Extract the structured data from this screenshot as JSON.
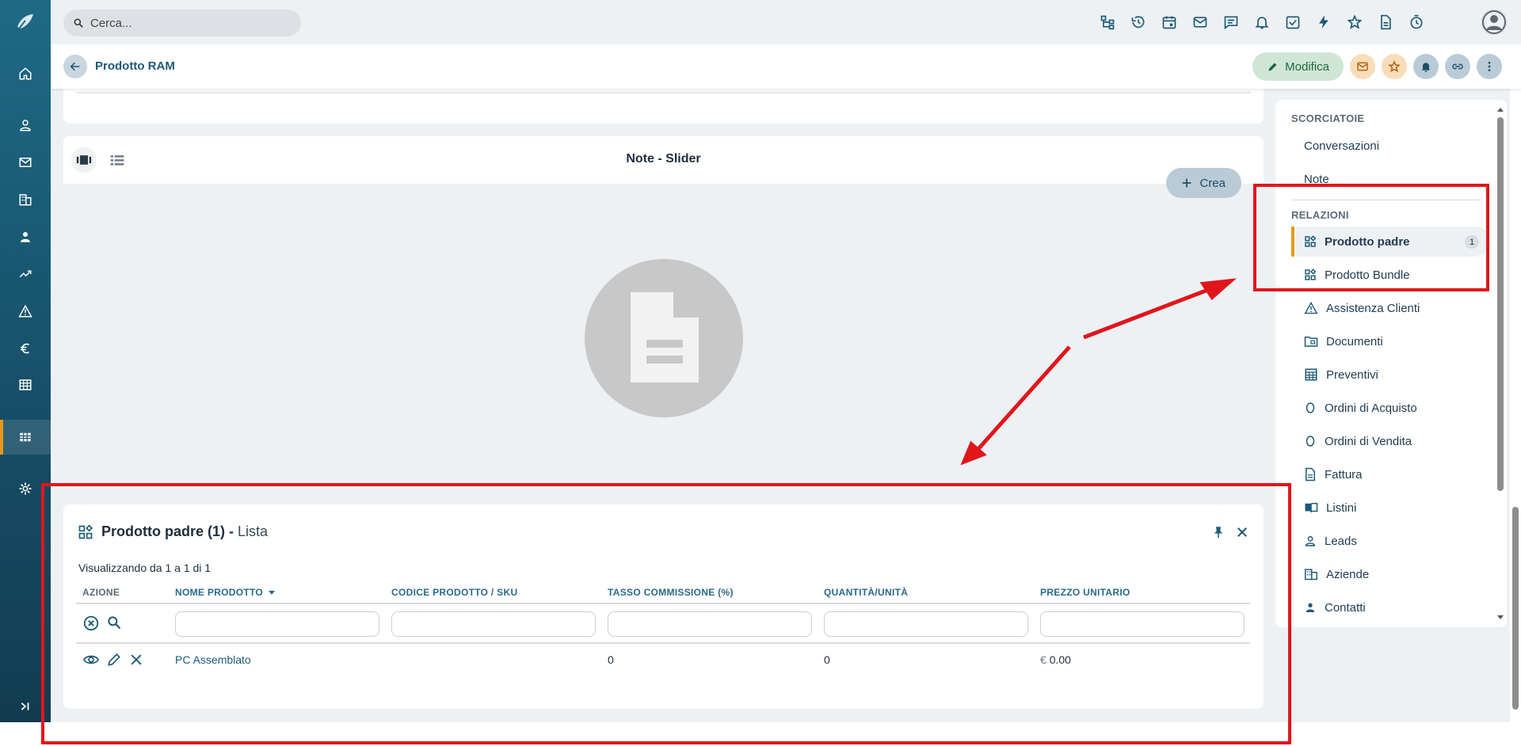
{
  "topbar": {
    "search_placeholder": "Cerca...",
    "icons": [
      "hierarchy-icon",
      "history-icon",
      "calendar-icon",
      "mail-icon",
      "chat-icon",
      "bell-icon",
      "check-icon",
      "bolt-icon",
      "star-icon",
      "document-icon",
      "timer-icon"
    ]
  },
  "sidebar": {
    "icons": [
      "home-icon",
      "user-icon",
      "mail-icon",
      "building-icon",
      "contact-icon",
      "trend-icon",
      "warning-icon",
      "euro-icon",
      "table-icon",
      "grid-icon",
      "settings-icon",
      "expand-icon"
    ],
    "active": "grid-icon"
  },
  "record": {
    "title": "Prodotto RAM",
    "edit_label": "Modifica"
  },
  "note_panel": {
    "title": "Note - Slider",
    "create_label": "Crea"
  },
  "list_panel": {
    "title_bold": "Prodotto padre (1)",
    "title_sep": " - ",
    "title_light": "Lista",
    "visualizing": "Visualizzando da 1 a 1 di 1",
    "columns": {
      "action": "AZIONE",
      "name": "NOME PRODOTTO",
      "code": "CODICE PRODOTTO / SKU",
      "commission": "TASSO COMMISSIONE (%)",
      "quantity": "QUANTITÀ/UNITÀ",
      "price": "PREZZO UNITARIO"
    },
    "rows": [
      {
        "name": "PC Assemblato",
        "code": "",
        "commission": "0",
        "quantity": "0",
        "currency": "€",
        "price": "0.00"
      }
    ]
  },
  "right_panel": {
    "shortcuts_label": "SCORCIATOIE",
    "shortcuts": [
      "Conversazioni",
      "Note"
    ],
    "relations_label": "RELAZIONI",
    "relations": [
      {
        "label": "Prodotto padre",
        "badge": "1"
      },
      {
        "label": "Prodotto Bundle"
      },
      {
        "label": "Assistenza Clienti"
      },
      {
        "label": "Documenti"
      },
      {
        "label": "Preventivi"
      },
      {
        "label": "Ordini di Acquisto"
      },
      {
        "label": "Ordini di Vendita"
      },
      {
        "label": "Fattura"
      },
      {
        "label": "Listini"
      },
      {
        "label": "Leads"
      },
      {
        "label": "Aziende"
      },
      {
        "label": "Contatti"
      }
    ]
  },
  "colors": {
    "sidebar": "#1e6a86",
    "accent": "#e59b1a",
    "primary_text": "#1d5a76",
    "highlight": "#e0161c"
  }
}
